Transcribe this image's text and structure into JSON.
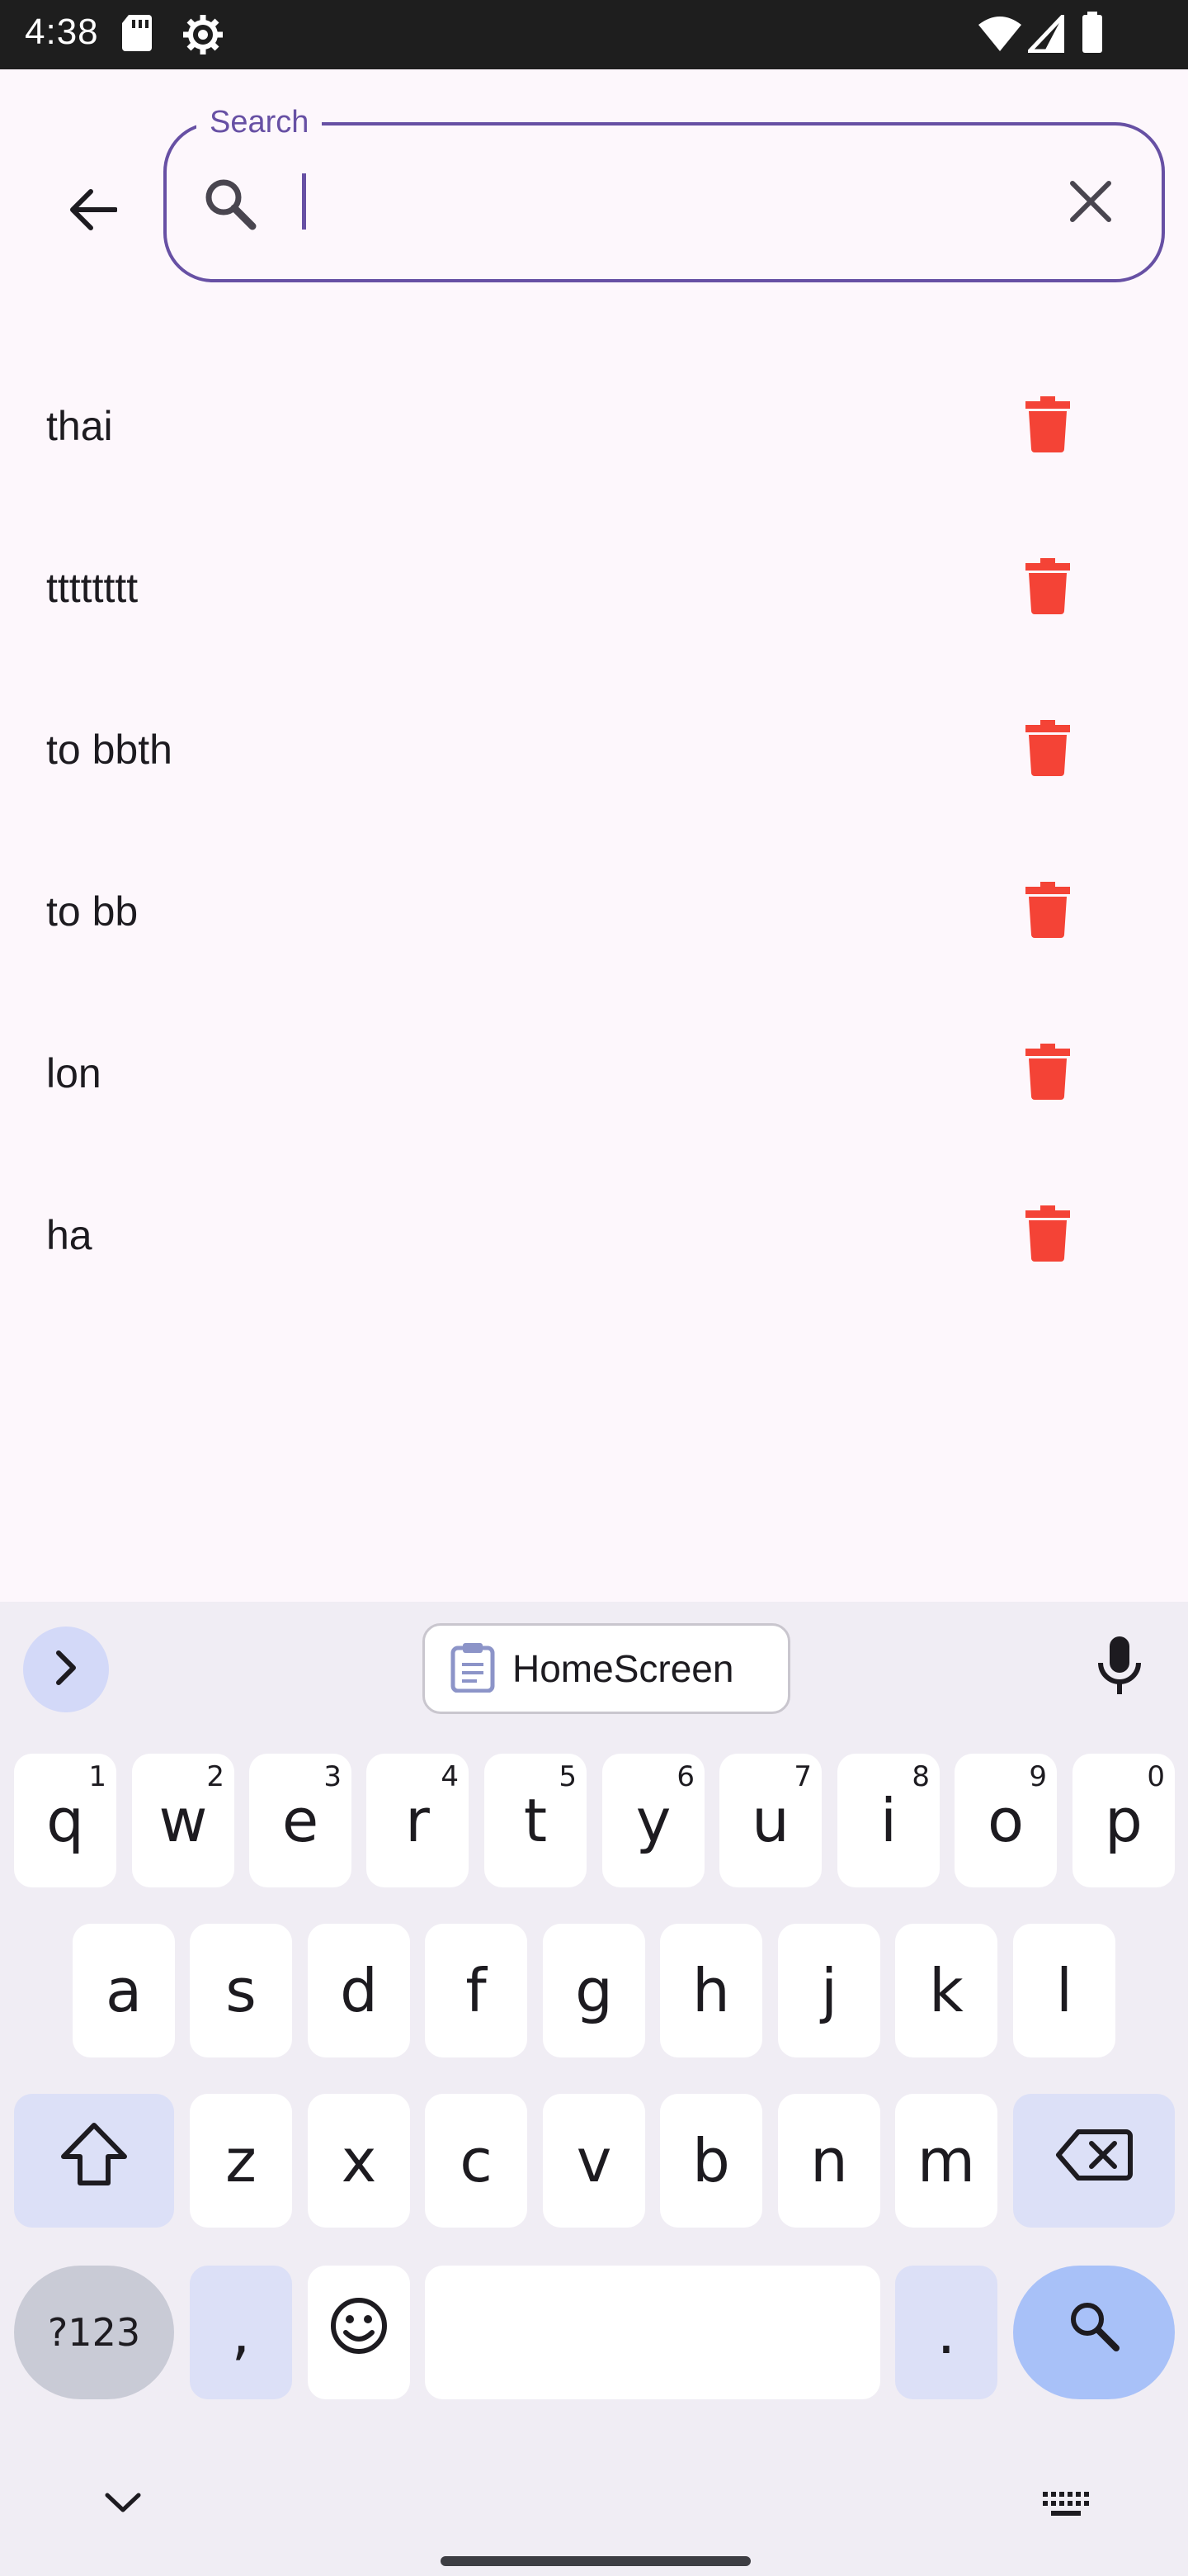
{
  "status_bar": {
    "time": "4:38",
    "icons": [
      "sd-card-icon",
      "settings-icon",
      "wifi-icon",
      "signal-icon",
      "battery-icon"
    ]
  },
  "search": {
    "label": "Search",
    "value": "",
    "placeholder": ""
  },
  "history": {
    "items": [
      {
        "label": "thai"
      },
      {
        "label": "tttttttt"
      },
      {
        "label": "to bbth"
      },
      {
        "label": "to bb"
      },
      {
        "label": "lon"
      },
      {
        "label": "ha"
      }
    ]
  },
  "keyboard": {
    "clipboard_chip": "HomeScreen",
    "row1": [
      {
        "key": "q",
        "hint": "1"
      },
      {
        "key": "w",
        "hint": "2"
      },
      {
        "key": "e",
        "hint": "3"
      },
      {
        "key": "r",
        "hint": "4"
      },
      {
        "key": "t",
        "hint": "5"
      },
      {
        "key": "y",
        "hint": "6"
      },
      {
        "key": "u",
        "hint": "7"
      },
      {
        "key": "i",
        "hint": "8"
      },
      {
        "key": "o",
        "hint": "9"
      },
      {
        "key": "p",
        "hint": "0"
      }
    ],
    "row2": [
      "a",
      "s",
      "d",
      "f",
      "g",
      "h",
      "j",
      "k",
      "l"
    ],
    "row3": [
      "z",
      "x",
      "c",
      "v",
      "b",
      "n",
      "m"
    ],
    "symbols_label": "?123",
    "comma": ",",
    "period": "."
  },
  "colors": {
    "accent": "#6750A4",
    "delete": "#F44336",
    "background": "#FDF7FC",
    "keyboard_bg": "#F0EDF4"
  }
}
